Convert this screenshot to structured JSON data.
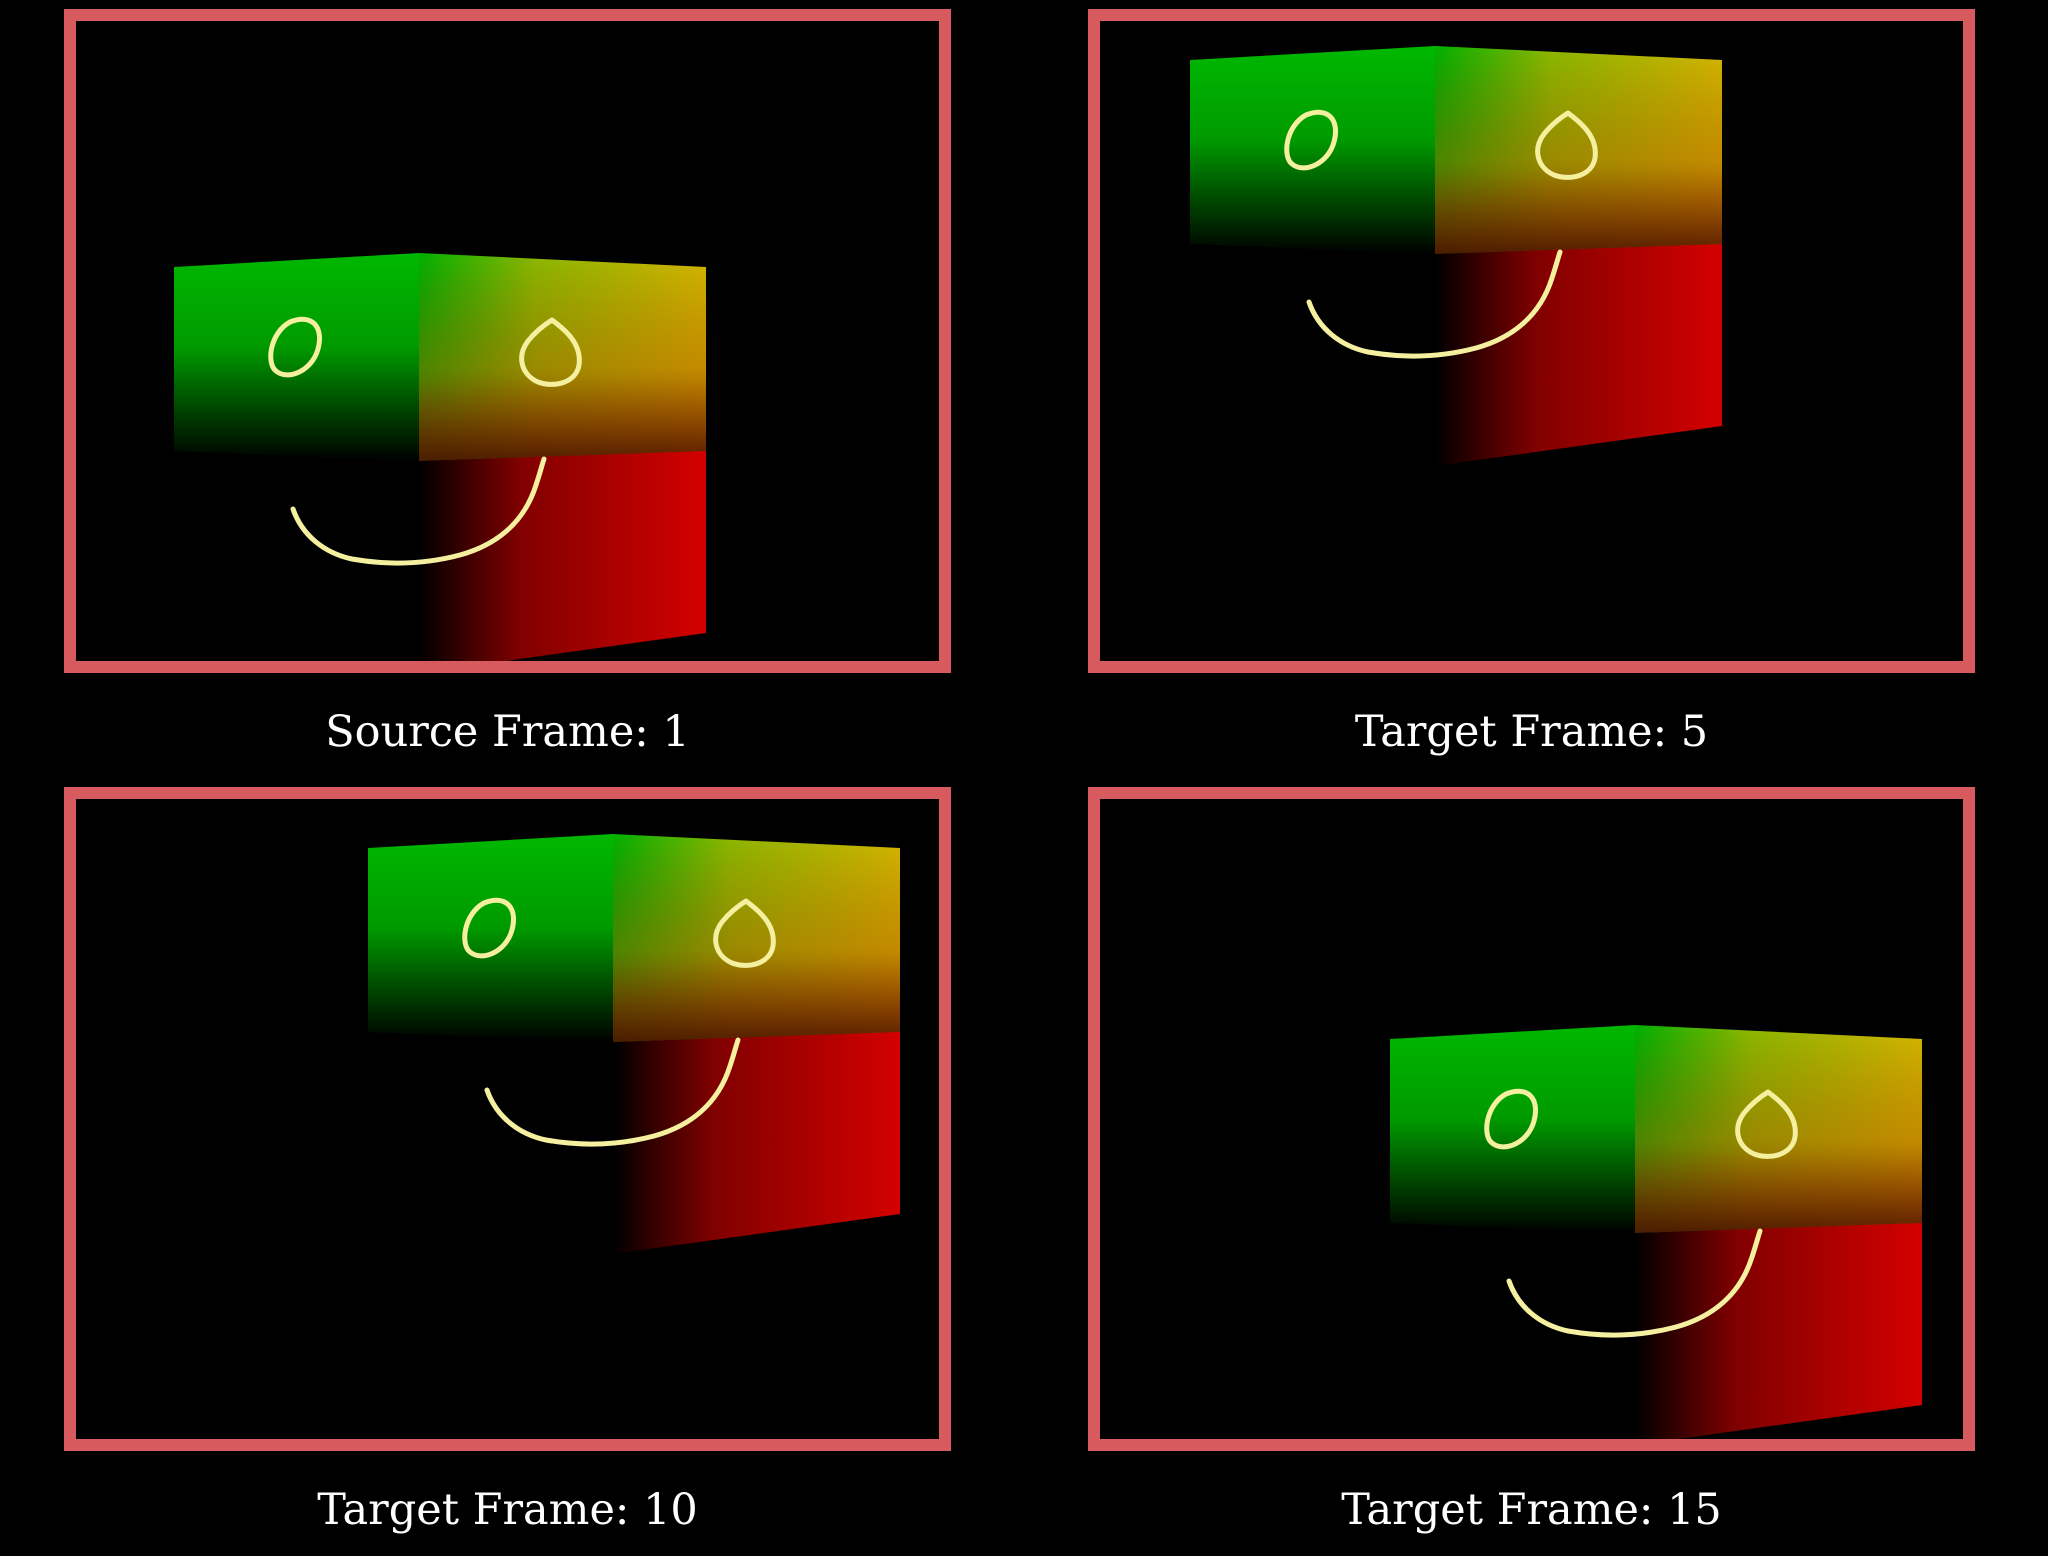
{
  "colors": {
    "frame_border": "#d65a5e",
    "background": "#000000",
    "caption_text": "#ffffff",
    "cube_green": "#00b800",
    "cube_yellow": "#d4b800",
    "cube_red": "#d40000",
    "doodle_stroke": "#f5f0a0"
  },
  "panels": [
    {
      "caption": "Source Frame: 1",
      "frame_index": 1,
      "content": "cube-with-smiley-face"
    },
    {
      "caption": "Target Frame: 5",
      "frame_index": 5,
      "content": "cube-with-smiley-face"
    },
    {
      "caption": "Target Frame: 10",
      "frame_index": 10,
      "content": "cube-with-smiley-face"
    },
    {
      "caption": "Target Frame: 15",
      "frame_index": 15,
      "content": "cube-with-smiley-face"
    }
  ]
}
